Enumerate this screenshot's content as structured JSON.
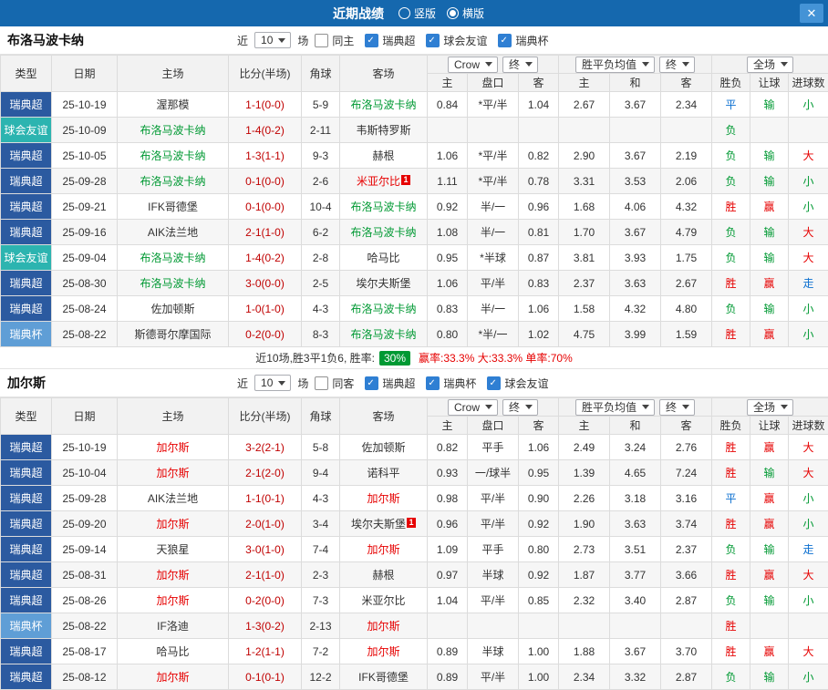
{
  "topbar": {
    "title": "近期战绩",
    "radios": [
      {
        "label": "竖版",
        "checked": false
      },
      {
        "label": "横版",
        "checked": true
      }
    ],
    "close_icon": "✕"
  },
  "colors": {
    "league": {
      "super": "#2b5aa0",
      "friendly": "#2cb4b0",
      "cup": "#5f9ed6"
    },
    "text": {
      "red": "#e60000",
      "green": "#009933",
      "blue": "#0b6fd0"
    },
    "topbar_bg": "#1568ae",
    "win_rate_badge_bg": "#009933"
  },
  "table_header": {
    "type": "类型",
    "date": "日期",
    "home": "主场",
    "score": "比分(半场)",
    "corner": "角球",
    "away": "客场",
    "odds_group": {
      "bookmaker": "Crow",
      "final": "终"
    },
    "avg_group": {
      "label": "胜平负均值",
      "final": "终"
    },
    "fullmatch": {
      "label": "全场"
    },
    "sub": [
      "主",
      "盘口",
      "客",
      "主",
      "和",
      "客",
      "胜负",
      "让球",
      "进球数"
    ]
  },
  "sections": [
    {
      "team": "布洛马波卡纳",
      "filter": {
        "near_label": "近",
        "match_count": "10",
        "games_label": "场",
        "checkboxes": [
          {
            "label": "同主",
            "checked": false
          },
          {
            "label": "瑞典超",
            "checked": true
          },
          {
            "label": "球会友谊",
            "checked": true
          },
          {
            "label": "瑞典杯",
            "checked": true
          }
        ]
      },
      "rows": [
        {
          "league": "瑞典超",
          "league_type": "super",
          "date": "25-10-19",
          "home": "渥那模",
          "home_color": "",
          "home_badge": "",
          "score": "1-1(0-0)",
          "corner": "5-9",
          "away": "布洛马波卡纳",
          "away_color": "green",
          "away_badge": "",
          "odds": [
            "0.84",
            "*平/半",
            "1.04"
          ],
          "avg": [
            "2.67",
            "3.67",
            "2.34"
          ],
          "results": [
            {
              "t": "平",
              "c": "blue"
            },
            {
              "t": "输",
              "c": "green"
            },
            {
              "t": "小",
              "c": "green"
            }
          ]
        },
        {
          "league": "球会友谊",
          "league_type": "friendly",
          "date": "25-10-09",
          "home": "布洛马波卡纳",
          "home_color": "green",
          "home_badge": "",
          "score": "1-4(0-2)",
          "corner": "2-11",
          "away": "韦斯特罗斯",
          "away_color": "",
          "away_badge": "",
          "odds": [
            "",
            "",
            ""
          ],
          "avg": [
            "",
            "",
            ""
          ],
          "results": [
            {
              "t": "负",
              "c": "green"
            },
            {
              "t": "",
              "c": ""
            },
            {
              "t": "",
              "c": ""
            }
          ]
        },
        {
          "league": "瑞典超",
          "league_type": "super",
          "date": "25-10-05",
          "home": "布洛马波卡纳",
          "home_color": "green",
          "home_badge": "",
          "score": "1-3(1-1)",
          "corner": "9-3",
          "away": "赫根",
          "away_color": "",
          "away_badge": "",
          "odds": [
            "1.06",
            "*平/半",
            "0.82"
          ],
          "avg": [
            "2.90",
            "3.67",
            "2.19"
          ],
          "results": [
            {
              "t": "负",
              "c": "green"
            },
            {
              "t": "输",
              "c": "green"
            },
            {
              "t": "大",
              "c": "red"
            }
          ]
        },
        {
          "league": "瑞典超",
          "league_type": "super",
          "date": "25-09-28",
          "home": "布洛马波卡纳",
          "home_color": "green",
          "home_badge": "",
          "score": "0-1(0-0)",
          "corner": "2-6",
          "away": "米亚尔比",
          "away_color": "red",
          "away_badge": "1",
          "odds": [
            "1.11",
            "*平/半",
            "0.78"
          ],
          "avg": [
            "3.31",
            "3.53",
            "2.06"
          ],
          "results": [
            {
              "t": "负",
              "c": "green"
            },
            {
              "t": "输",
              "c": "green"
            },
            {
              "t": "小",
              "c": "green"
            }
          ]
        },
        {
          "league": "瑞典超",
          "league_type": "super",
          "date": "25-09-21",
          "home": "IFK哥德堡",
          "home_color": "",
          "home_badge": "",
          "score": "0-1(0-0)",
          "corner": "10-4",
          "away": "布洛马波卡纳",
          "away_color": "green",
          "away_badge": "",
          "odds": [
            "0.92",
            "半/一",
            "0.96"
          ],
          "avg": [
            "1.68",
            "4.06",
            "4.32"
          ],
          "results": [
            {
              "t": "胜",
              "c": "red"
            },
            {
              "t": "赢",
              "c": "red"
            },
            {
              "t": "小",
              "c": "green"
            }
          ]
        },
        {
          "league": "瑞典超",
          "league_type": "super",
          "date": "25-09-16",
          "home": "AIK法兰地",
          "home_color": "",
          "home_badge": "",
          "score": "2-1(1-0)",
          "corner": "6-2",
          "away": "布洛马波卡纳",
          "away_color": "green",
          "away_badge": "",
          "odds": [
            "1.08",
            "半/一",
            "0.81"
          ],
          "avg": [
            "1.70",
            "3.67",
            "4.79"
          ],
          "results": [
            {
              "t": "负",
              "c": "green"
            },
            {
              "t": "输",
              "c": "green"
            },
            {
              "t": "大",
              "c": "red"
            }
          ]
        },
        {
          "league": "球会友谊",
          "league_type": "friendly",
          "date": "25-09-04",
          "home": "布洛马波卡纳",
          "home_color": "green",
          "home_badge": "",
          "score": "1-4(0-2)",
          "corner": "2-8",
          "away": "哈马比",
          "away_color": "",
          "away_badge": "",
          "odds": [
            "0.95",
            "*半球",
            "0.87"
          ],
          "avg": [
            "3.81",
            "3.93",
            "1.75"
          ],
          "results": [
            {
              "t": "负",
              "c": "green"
            },
            {
              "t": "输",
              "c": "green"
            },
            {
              "t": "大",
              "c": "red"
            }
          ]
        },
        {
          "league": "瑞典超",
          "league_type": "super",
          "date": "25-08-30",
          "home": "布洛马波卡纳",
          "home_color": "green",
          "home_badge": "",
          "score": "3-0(0-0)",
          "corner": "2-5",
          "away": "埃尔夫斯堡",
          "away_color": "",
          "away_badge": "",
          "odds": [
            "1.06",
            "平/半",
            "0.83"
          ],
          "avg": [
            "2.37",
            "3.63",
            "2.67"
          ],
          "results": [
            {
              "t": "胜",
              "c": "red"
            },
            {
              "t": "赢",
              "c": "red"
            },
            {
              "t": "走",
              "c": "blue"
            }
          ]
        },
        {
          "league": "瑞典超",
          "league_type": "super",
          "date": "25-08-24",
          "home": "佐加顿斯",
          "home_color": "",
          "home_badge": "",
          "score": "1-0(1-0)",
          "corner": "4-3",
          "away": "布洛马波卡纳",
          "away_color": "green",
          "away_badge": "",
          "odds": [
            "0.83",
            "半/一",
            "1.06"
          ],
          "avg": [
            "1.58",
            "4.32",
            "4.80"
          ],
          "results": [
            {
              "t": "负",
              "c": "green"
            },
            {
              "t": "输",
              "c": "green"
            },
            {
              "t": "小",
              "c": "green"
            }
          ]
        },
        {
          "league": "瑞典杯",
          "league_type": "cup",
          "date": "25-08-22",
          "home": "斯德哥尔摩国际",
          "home_color": "",
          "home_badge": "",
          "score": "0-2(0-0)",
          "corner": "8-3",
          "away": "布洛马波卡纳",
          "away_color": "green",
          "away_badge": "",
          "odds": [
            "0.80",
            "*半/一",
            "1.02"
          ],
          "avg": [
            "4.75",
            "3.99",
            "1.59"
          ],
          "results": [
            {
              "t": "胜",
              "c": "red"
            },
            {
              "t": "赢",
              "c": "red"
            },
            {
              "t": "小",
              "c": "green"
            }
          ]
        }
      ],
      "summary": {
        "prefix": "近10场,胜3平1负6, 胜率:",
        "win_rate": "30%",
        "stats": "赢率:33.3% 大:33.3% 单率:70%"
      }
    },
    {
      "team": "加尔斯",
      "filter": {
        "near_label": "近",
        "match_count": "10",
        "games_label": "场",
        "checkboxes": [
          {
            "label": "同客",
            "checked": false
          },
          {
            "label": "瑞典超",
            "checked": true
          },
          {
            "label": "瑞典杯",
            "checked": true
          },
          {
            "label": "球会友谊",
            "checked": true
          }
        ]
      },
      "rows": [
        {
          "league": "瑞典超",
          "league_type": "super",
          "date": "25-10-19",
          "home": "加尔斯",
          "home_color": "red",
          "home_badge": "",
          "score": "3-2(2-1)",
          "corner": "5-8",
          "away": "佐加顿斯",
          "away_color": "",
          "away_badge": "",
          "odds": [
            "0.82",
            "平手",
            "1.06"
          ],
          "avg": [
            "2.49",
            "3.24",
            "2.76"
          ],
          "results": [
            {
              "t": "胜",
              "c": "red"
            },
            {
              "t": "赢",
              "c": "red"
            },
            {
              "t": "大",
              "c": "red"
            }
          ]
        },
        {
          "league": "瑞典超",
          "league_type": "super",
          "date": "25-10-04",
          "home": "加尔斯",
          "home_color": "red",
          "home_badge": "",
          "score": "2-1(2-0)",
          "corner": "9-4",
          "away": "诺科平",
          "away_color": "",
          "away_badge": "",
          "odds": [
            "0.93",
            "一/球半",
            "0.95"
          ],
          "avg": [
            "1.39",
            "4.65",
            "7.24"
          ],
          "results": [
            {
              "t": "胜",
              "c": "red"
            },
            {
              "t": "输",
              "c": "green"
            },
            {
              "t": "大",
              "c": "red"
            }
          ]
        },
        {
          "league": "瑞典超",
          "league_type": "super",
          "date": "25-09-28",
          "home": "AIK法兰地",
          "home_color": "",
          "home_badge": "",
          "score": "1-1(0-1)",
          "corner": "4-3",
          "away": "加尔斯",
          "away_color": "red",
          "away_badge": "",
          "odds": [
            "0.98",
            "平/半",
            "0.90"
          ],
          "avg": [
            "2.26",
            "3.18",
            "3.16"
          ],
          "results": [
            {
              "t": "平",
              "c": "blue"
            },
            {
              "t": "赢",
              "c": "red"
            },
            {
              "t": "小",
              "c": "green"
            }
          ]
        },
        {
          "league": "瑞典超",
          "league_type": "super",
          "date": "25-09-20",
          "home": "加尔斯",
          "home_color": "red",
          "home_badge": "",
          "score": "2-0(1-0)",
          "corner": "3-4",
          "away": "埃尔夫斯堡",
          "away_color": "",
          "away_badge": "1",
          "odds": [
            "0.96",
            "平/半",
            "0.92"
          ],
          "avg": [
            "1.90",
            "3.63",
            "3.74"
          ],
          "results": [
            {
              "t": "胜",
              "c": "red"
            },
            {
              "t": "赢",
              "c": "red"
            },
            {
              "t": "小",
              "c": "green"
            }
          ]
        },
        {
          "league": "瑞典超",
          "league_type": "super",
          "date": "25-09-14",
          "home": "天狼星",
          "home_color": "",
          "home_badge": "",
          "score": "3-0(1-0)",
          "corner": "7-4",
          "away": "加尔斯",
          "away_color": "red",
          "away_badge": "",
          "odds": [
            "1.09",
            "平手",
            "0.80"
          ],
          "avg": [
            "2.73",
            "3.51",
            "2.37"
          ],
          "results": [
            {
              "t": "负",
              "c": "green"
            },
            {
              "t": "输",
              "c": "green"
            },
            {
              "t": "走",
              "c": "blue"
            }
          ]
        },
        {
          "league": "瑞典超",
          "league_type": "super",
          "date": "25-08-31",
          "home": "加尔斯",
          "home_color": "red",
          "home_badge": "",
          "score": "2-1(1-0)",
          "corner": "2-3",
          "away": "赫根",
          "away_color": "",
          "away_badge": "",
          "odds": [
            "0.97",
            "半球",
            "0.92"
          ],
          "avg": [
            "1.87",
            "3.77",
            "3.66"
          ],
          "results": [
            {
              "t": "胜",
              "c": "red"
            },
            {
              "t": "赢",
              "c": "red"
            },
            {
              "t": "大",
              "c": "red"
            }
          ]
        },
        {
          "league": "瑞典超",
          "league_type": "super",
          "date": "25-08-26",
          "home": "加尔斯",
          "home_color": "red",
          "home_badge": "",
          "score": "0-2(0-0)",
          "corner": "7-3",
          "away": "米亚尔比",
          "away_color": "",
          "away_badge": "",
          "odds": [
            "1.04",
            "平/半",
            "0.85"
          ],
          "avg": [
            "2.32",
            "3.40",
            "2.87"
          ],
          "results": [
            {
              "t": "负",
              "c": "green"
            },
            {
              "t": "输",
              "c": "green"
            },
            {
              "t": "小",
              "c": "green"
            }
          ]
        },
        {
          "league": "瑞典杯",
          "league_type": "cup",
          "date": "25-08-22",
          "home": "IF洛迪",
          "home_color": "",
          "home_badge": "",
          "score": "1-3(0-2)",
          "corner": "2-13",
          "away": "加尔斯",
          "away_color": "red",
          "away_badge": "",
          "odds": [
            "",
            "",
            ""
          ],
          "avg": [
            "",
            "",
            ""
          ],
          "results": [
            {
              "t": "胜",
              "c": "red"
            },
            {
              "t": "",
              "c": ""
            },
            {
              "t": "",
              "c": ""
            }
          ]
        },
        {
          "league": "瑞典超",
          "league_type": "super",
          "date": "25-08-17",
          "home": "哈马比",
          "home_color": "",
          "home_badge": "",
          "score": "1-2(1-1)",
          "corner": "7-2",
          "away": "加尔斯",
          "away_color": "red",
          "away_badge": "",
          "odds": [
            "0.89",
            "半球",
            "1.00"
          ],
          "avg": [
            "1.88",
            "3.67",
            "3.70"
          ],
          "results": [
            {
              "t": "胜",
              "c": "red"
            },
            {
              "t": "赢",
              "c": "red"
            },
            {
              "t": "大",
              "c": "red"
            }
          ]
        },
        {
          "league": "瑞典超",
          "league_type": "super",
          "date": "25-08-12",
          "home": "加尔斯",
          "home_color": "red",
          "home_badge": "",
          "score": "0-1(0-1)",
          "corner": "12-2",
          "away": "IFK哥德堡",
          "away_color": "",
          "away_badge": "",
          "odds": [
            "0.89",
            "平/半",
            "1.00"
          ],
          "avg": [
            "2.34",
            "3.32",
            "2.87"
          ],
          "results": [
            {
              "t": "负",
              "c": "green"
            },
            {
              "t": "输",
              "c": "green"
            },
            {
              "t": "小",
              "c": "green"
            }
          ]
        }
      ]
    }
  ]
}
